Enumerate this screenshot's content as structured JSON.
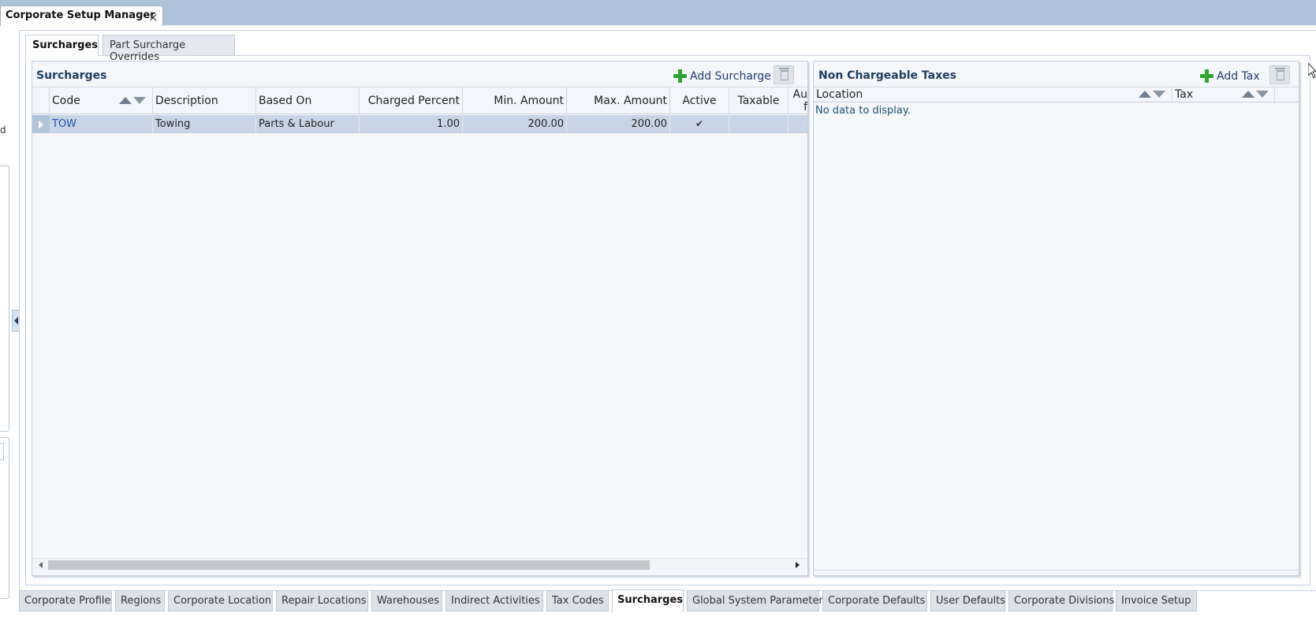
{
  "window": {
    "tab_title": "Corporate Setup Manager",
    "close_glyph": "×"
  },
  "left_pane": {
    "fragment_letter": "d"
  },
  "subtabs": [
    {
      "label": "Surcharges",
      "active": true
    },
    {
      "label": "Part Surcharge Overrides",
      "active": false
    }
  ],
  "surcharges_panel": {
    "title": "Surcharges",
    "add_label": "Add Surcharge",
    "add_icon": "plus-icon",
    "delete_icon": "trash-icon",
    "columns": [
      "Code",
      "Description",
      "Based On",
      "Charged Percent",
      "Min. Amount",
      "Max. Amount",
      "Active",
      "Taxable",
      "Au",
      "f"
    ],
    "rows": [
      {
        "code": "TOW",
        "description": "Towing",
        "based_on": "Parts & Labour",
        "charged_percent": "1.00",
        "min_amount": "200.00",
        "max_amount": "200.00",
        "active": "✔",
        "taxable": ""
      }
    ]
  },
  "taxes_panel": {
    "title": "Non Chargeable Taxes",
    "add_label": "Add Tax",
    "add_icon": "plus-icon",
    "delete_icon": "trash-icon",
    "columns": [
      "Location",
      "Tax"
    ],
    "empty_text": "No data to display."
  },
  "bottom_tabs": [
    {
      "label": "Corporate Profile"
    },
    {
      "label": "Regions"
    },
    {
      "label": "Corporate Location"
    },
    {
      "label": "Repair Locations"
    },
    {
      "label": "Warehouses"
    },
    {
      "label": "Indirect Activities"
    },
    {
      "label": "Tax Codes"
    },
    {
      "label": "Surcharges",
      "active": true
    },
    {
      "label": "Global System Parameters"
    },
    {
      "label": "Corporate Defaults"
    },
    {
      "label": "User Defaults"
    },
    {
      "label": "Corporate Divisions"
    },
    {
      "label": "Invoice Setup"
    }
  ],
  "colors": {
    "header_strip": "#adc3d9",
    "selected_row": "#c7d5e6",
    "title_text": "#1d3d5f",
    "add_icon": "#2fa22f"
  }
}
